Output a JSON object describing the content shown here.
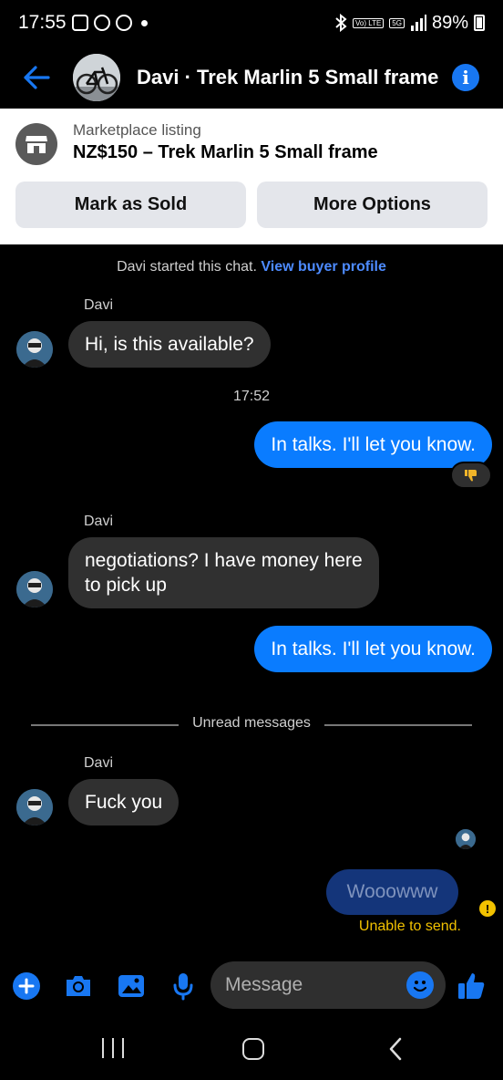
{
  "status_bar": {
    "time": "17:55",
    "battery": "89%",
    "network": "5G",
    "lte_label": "Vo) LTE"
  },
  "header": {
    "title": "Davi · Trek Marlin 5 Small frame"
  },
  "marketplace": {
    "label": "Marketplace listing",
    "title": "NZ$150 – Trek Marlin 5 Small frame",
    "mark_sold": "Mark as Sold",
    "more_options": "More Options"
  },
  "chat": {
    "start_text": "Davi started this chat.",
    "view_profile": "View buyer profile",
    "messages": [
      {
        "sender": "Davi",
        "text": "Hi, is this available?"
      },
      {
        "timestamp": "17:52"
      },
      {
        "text": "In talks. I'll let you know.",
        "reaction": "👎"
      },
      {
        "sender": "Davi",
        "text_line1": "negotiations? I have money here",
        "text_line2": "to pick up"
      },
      {
        "text": "In talks. I'll let you know."
      },
      {
        "sender": "Davi",
        "text": "Fuck you"
      },
      {
        "text": "Wooowww",
        "status": "Unable to send."
      }
    ],
    "unread_label": "Unread messages"
  },
  "composer": {
    "placeholder": "Message"
  },
  "colors": {
    "accent": "#0a7cff",
    "incoming_bubble": "#303030",
    "warning": "#f2c200"
  }
}
